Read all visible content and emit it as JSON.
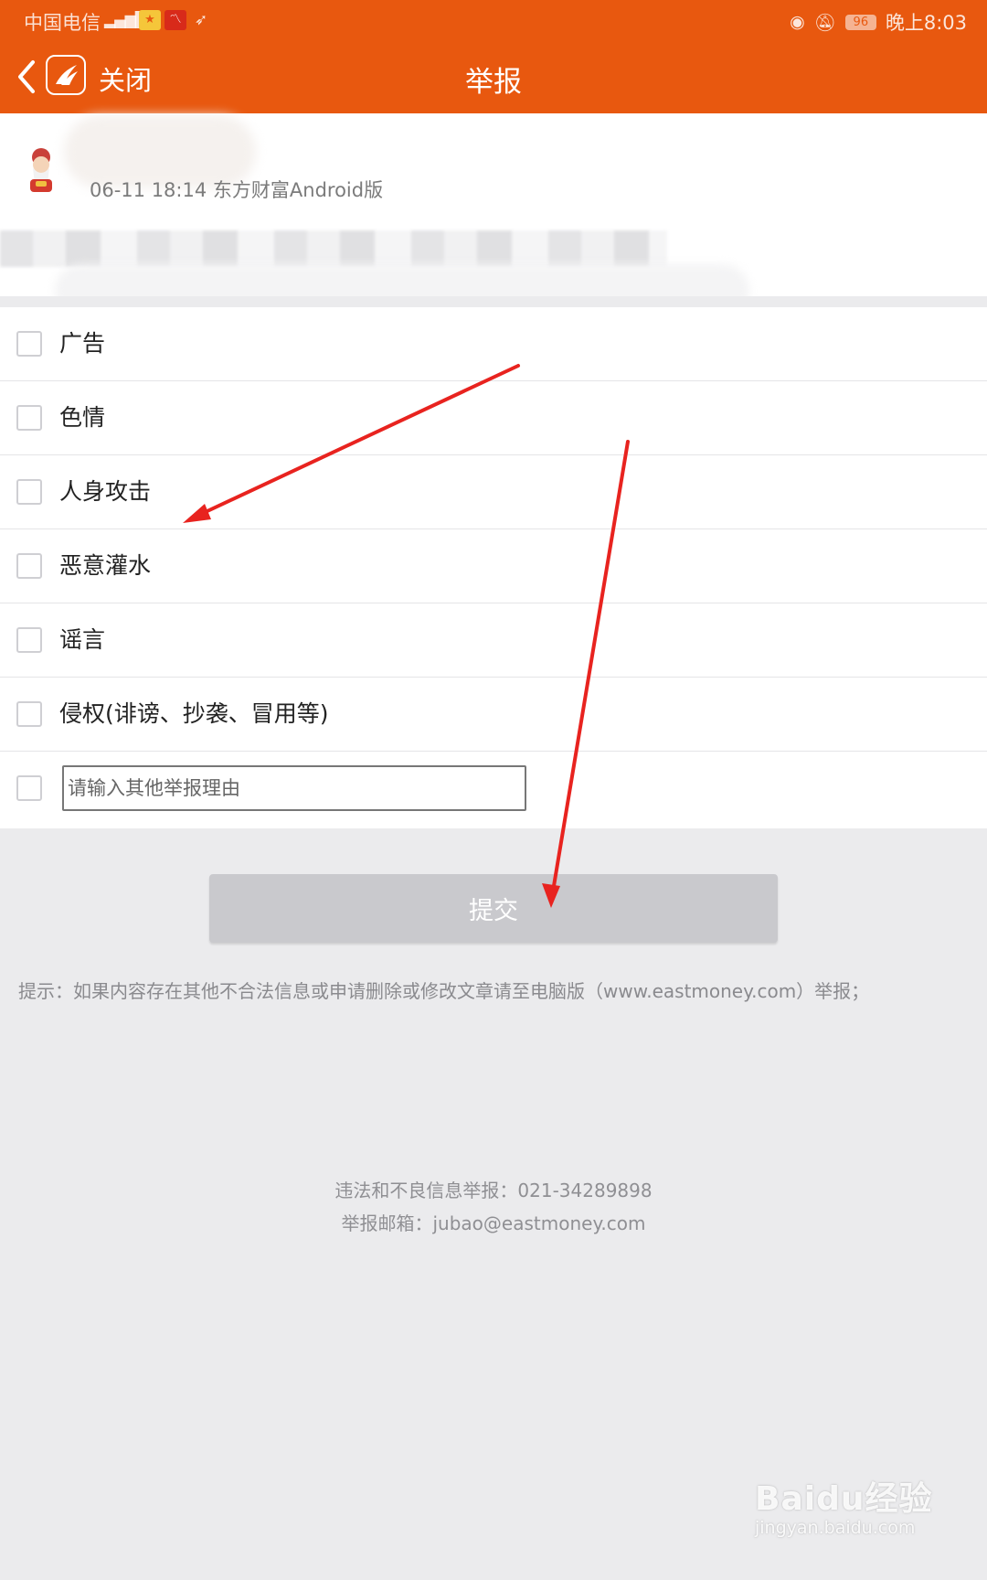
{
  "status_bar": {
    "carrier": "中国电信",
    "signal": "4G",
    "time": "晚上8:03",
    "battery": "96"
  },
  "header": {
    "close_label": "关闭",
    "title": "举报"
  },
  "post": {
    "meta": "06-11 18:14 东方财富Android版"
  },
  "options": [
    {
      "label": "广告"
    },
    {
      "label": "色情"
    },
    {
      "label": "人身攻击"
    },
    {
      "label": "恶意灌水"
    },
    {
      "label": "谣言"
    },
    {
      "label": "侵权(诽谤、抄袭、冒用等)"
    }
  ],
  "other_reason": {
    "placeholder": "请输入其他举报理由",
    "value": ""
  },
  "submit_label": "提交",
  "tip": "提示：如果内容存在其他不合法信息或申请删除或修改文章请至电脑版（www.eastmoney.com）举报；",
  "contact": {
    "phone_line": "违法和不良信息举报：021-34289898",
    "email_line": "举报邮箱：jubao@eastmoney.com"
  },
  "watermark": {
    "brand": "Baidu经验",
    "url": "jingyan.baidu.com"
  },
  "colors": {
    "header_bg": "#e8580f",
    "page_bg": "#ebebed",
    "submit_disabled": "#c9c9cd",
    "annotation_arrow": "#e8231f"
  },
  "icons": [
    "back-arrow-icon",
    "app-logo-icon",
    "eye-icon",
    "bell-muted-icon",
    "battery-icon",
    "signal-icon"
  ]
}
